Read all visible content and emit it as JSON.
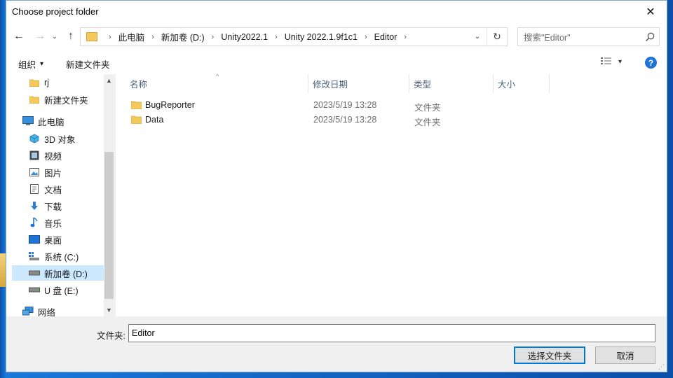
{
  "window": {
    "title": "Choose project folder",
    "close_glyph": "✕"
  },
  "nav": {
    "back_glyph": "←",
    "forward_glyph": "→",
    "recent_glyph": "⌄",
    "up_glyph": "↑",
    "breadcrumbs": [
      "此电脑",
      "新加卷 (D:)",
      "Unity2022.1",
      "Unity 2022.1.9f1c1",
      "Editor"
    ],
    "separator_glyph": "›",
    "dropdown_glyph": "⌄",
    "refresh_glyph": "↻",
    "search_placeholder": "搜索\"Editor\""
  },
  "toolbar": {
    "organize_label": "组织",
    "organize_arrow": "▾",
    "new_folder_label": "新建文件夹",
    "view_arrow": "▾",
    "help_glyph": "?"
  },
  "sidebar": {
    "items": [
      {
        "label": "rj",
        "icon": "folder-icon"
      },
      {
        "label": "新建文件夹",
        "icon": "folder-icon"
      },
      {
        "label": "此电脑",
        "icon": "computer-icon"
      },
      {
        "label": "3D 对象",
        "icon": "cube-icon"
      },
      {
        "label": "视频",
        "icon": "video-icon"
      },
      {
        "label": "图片",
        "icon": "picture-icon"
      },
      {
        "label": "文档",
        "icon": "document-icon"
      },
      {
        "label": "下载",
        "icon": "download-icon"
      },
      {
        "label": "音乐",
        "icon": "music-icon"
      },
      {
        "label": "桌面",
        "icon": "desktop-icon"
      },
      {
        "label": "系统 (C:)",
        "icon": "drive-icon"
      },
      {
        "label": "新加卷 (D:)",
        "icon": "drive-icon",
        "selected": true
      },
      {
        "label": "U 盘 (E:)",
        "icon": "usb-drive-icon"
      },
      {
        "label": "网络",
        "icon": "network-icon"
      }
    ],
    "scroll_up_glyph": "▲",
    "scroll_down_glyph": "▼"
  },
  "content": {
    "sort_glyph": "^",
    "columns": [
      "名称",
      "修改日期",
      "类型",
      "大小"
    ],
    "rows": [
      {
        "name": "BugReporter",
        "modified": "2023/5/19 13:28",
        "type": "文件夹",
        "size": ""
      },
      {
        "name": "Data",
        "modified": "2023/5/19 13:28",
        "type": "文件夹",
        "size": ""
      }
    ]
  },
  "footer": {
    "folder_label": "文件夹:",
    "folder_value": "Editor",
    "select_button": "选择文件夹",
    "cancel_button": "取消",
    "resize_glyph": "⋰"
  },
  "colors": {
    "accent": "#0078d7",
    "selection": "#cce8ff",
    "folder": "#f3c95b",
    "help": "#1e73d6"
  }
}
